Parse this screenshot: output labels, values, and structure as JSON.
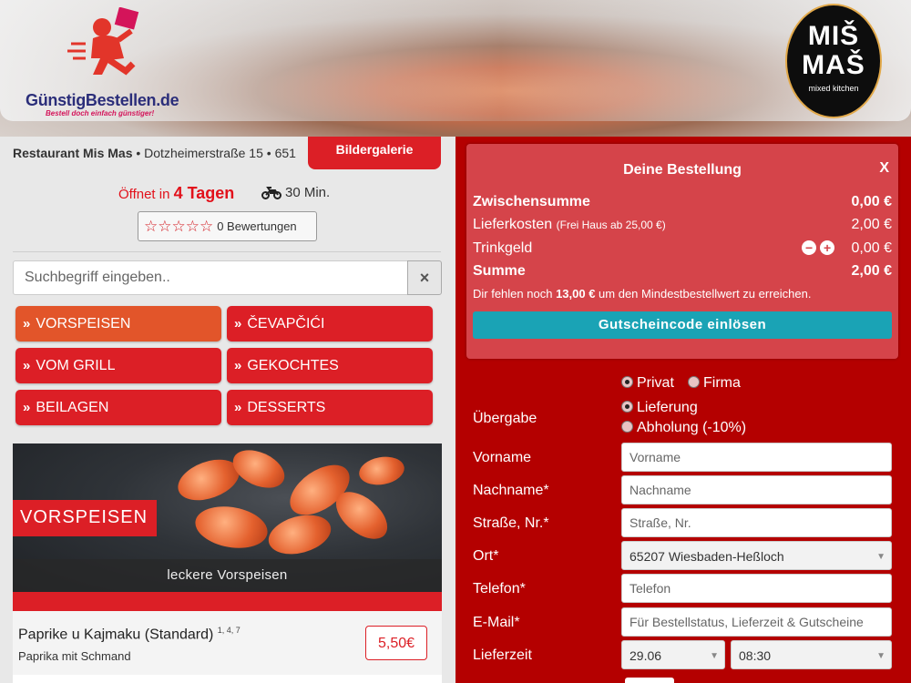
{
  "header": {
    "brand_name": "GünstigBestellen.de",
    "brand_slogan": "Bestell doch einfach günstiger!",
    "restaurant_logo": {
      "line1": "MIŠ",
      "line2": "MAŠ",
      "line3": "mixed kitchen"
    }
  },
  "restaurant": {
    "info_name": "Restaurant Mis Mas",
    "info_address": " • Dotzheimerstraße 15 • 651",
    "gallery_label": "Bildergalerie",
    "opening_prefix": "Öffnet in ",
    "opening_value": "4 Tagen",
    "delivery_time": "30 Min.",
    "stars": "☆☆☆☆☆",
    "ratings_label": "0 Bewertungen"
  },
  "search": {
    "placeholder": "Suchbegriff eingeben..",
    "clear_icon": "×"
  },
  "categories": [
    {
      "label": "VORSPEISEN",
      "active": true
    },
    {
      "label": "ČEVAPČIĆI",
      "active": false
    },
    {
      "label": "VOM GRILL",
      "active": false
    },
    {
      "label": "GEKOCHTES",
      "active": false
    },
    {
      "label": "BEILAGEN",
      "active": false
    },
    {
      "label": "DESSERTS",
      "active": false
    }
  ],
  "section": {
    "title": "VORSPEISEN",
    "subtitle": "leckere Vorspeisen"
  },
  "menu_items": [
    {
      "name": "Paprike u Kajmaku (Standard)",
      "allergens": "1, 4, 7",
      "description": "Paprika mit Schmand",
      "price": "5,50€"
    }
  ],
  "cart": {
    "title": "Deine Bestellung",
    "close_label": "X",
    "subtotal_label": "Zwischensumme",
    "subtotal_value": "0,00 €",
    "delivery_label": "Lieferkosten",
    "delivery_note": "(Frei Haus ab 25,00 €)",
    "delivery_value": "2,00 €",
    "tip_label": "Trinkgeld",
    "tip_value": "0,00 €",
    "total_label": "Summe",
    "total_value": "2,00 €",
    "hint_prefix": "Dir fehlen noch ",
    "hint_amount": "13,00 €",
    "hint_suffix": " um den Mindestbestellwert zu erreichen.",
    "voucher_label": "Gutscheincode einlösen"
  },
  "form": {
    "customer_type": {
      "private": "Privat",
      "company": "Firma",
      "selected": "Privat"
    },
    "handover": {
      "label": "Übergabe",
      "delivery": "Lieferung",
      "pickup": "Abholung (-10%)",
      "selected": "Lieferung"
    },
    "firstname": {
      "label": "Vorname",
      "placeholder": "Vorname"
    },
    "lastname": {
      "label": "Nachname*",
      "placeholder": "Nachname"
    },
    "street": {
      "label": "Straße, Nr.*",
      "placeholder": "Straße, Nr."
    },
    "city": {
      "label": "Ort*",
      "value": "65207 Wiesbaden-Heßloch"
    },
    "phone": {
      "label": "Telefon*",
      "placeholder": "Telefon"
    },
    "email": {
      "label": "E-Mail*",
      "placeholder": "Für Bestellstatus, Lieferzeit & Gutscheine"
    },
    "delivery_time": {
      "label": "Lieferzeit",
      "date": "29.06",
      "time": "08:30"
    }
  },
  "colors": {
    "brand_red": "#dc1f26",
    "active_category": "#e2552a",
    "cart_bg": "#d5444a",
    "voucher": "#1aa3b5",
    "panel_bg": "#b40000"
  },
  "icons": {
    "rating": "star-icon",
    "delivery": "motorbike-icon",
    "category": "double-chevron-icon",
    "tip_minus": "minus-circle-icon",
    "tip_plus": "plus-circle-icon"
  }
}
